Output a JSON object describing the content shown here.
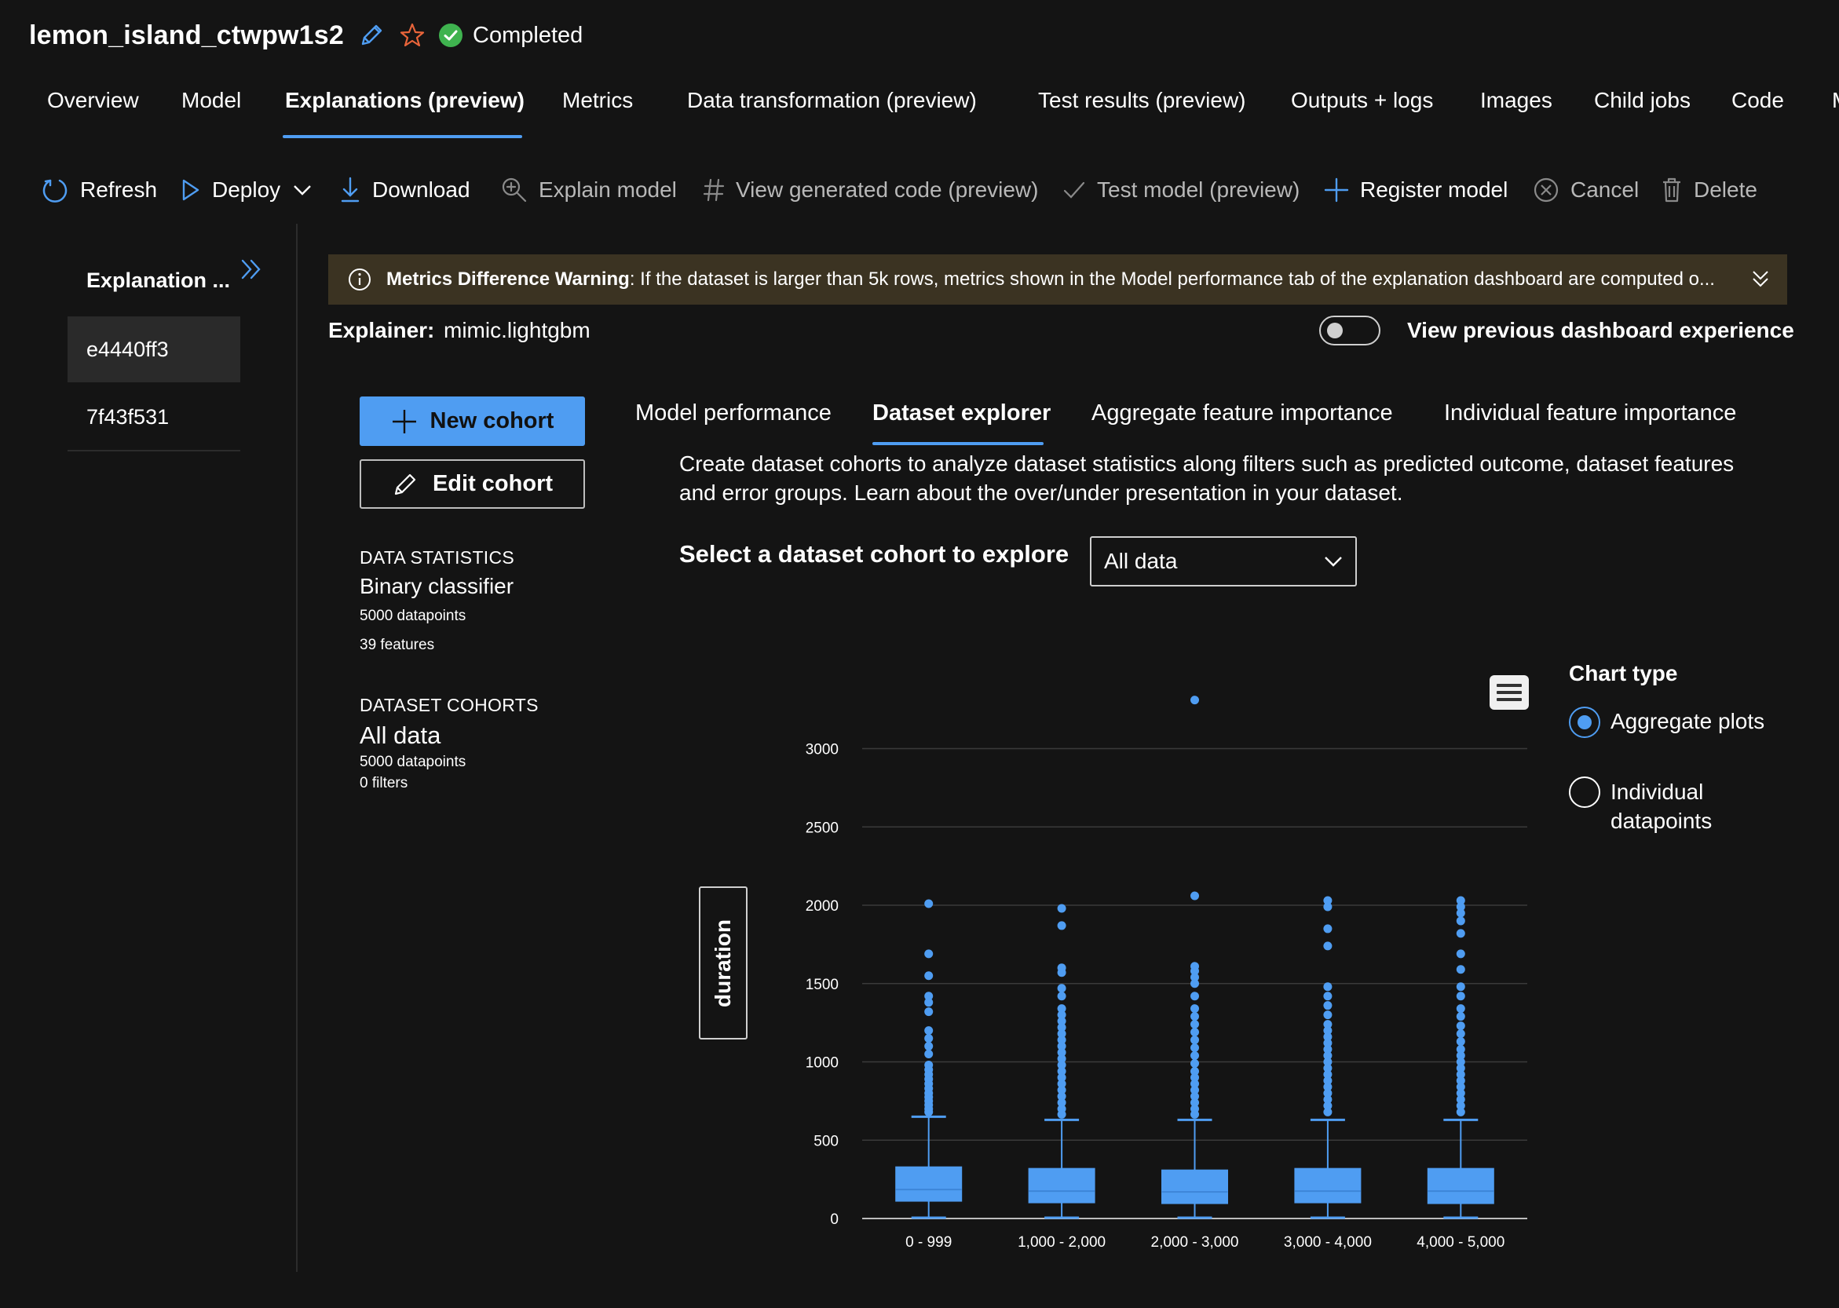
{
  "header": {
    "job_title": "lemon_island_ctwpw1s2",
    "status": "Completed"
  },
  "nav": {
    "tabs": [
      {
        "label": "Overview"
      },
      {
        "label": "Model"
      },
      {
        "label": "Explanations (preview)",
        "active": true
      },
      {
        "label": "Metrics"
      },
      {
        "label": "Data transformation (preview)"
      },
      {
        "label": "Test results (preview)"
      },
      {
        "label": "Outputs + logs"
      },
      {
        "label": "Images"
      },
      {
        "label": "Child jobs"
      },
      {
        "label": "Code"
      },
      {
        "label": "M"
      }
    ]
  },
  "toolbar": {
    "refresh": "Refresh",
    "deploy": "Deploy",
    "download": "Download",
    "explain_model": "Explain model",
    "view_generated_code": "View generated code (preview)",
    "test_model": "Test model (preview)",
    "register_model": "Register model",
    "cancel": "Cancel",
    "delete": "Delete"
  },
  "explanations": {
    "header": "Explanation ...",
    "items": [
      {
        "id": "e4440ff3",
        "selected": true
      },
      {
        "id": "7f43f531",
        "selected": false
      }
    ]
  },
  "warning": {
    "title": "Metrics Difference Warning",
    "text": ": If the dataset is larger than 5k rows, metrics shown in the Model performance tab of the explanation dashboard are computed o..."
  },
  "explainer": {
    "label": "Explainer:",
    "value": "mimic.lightgbm"
  },
  "toggle": {
    "label": "View previous dashboard experience",
    "on": false
  },
  "cohort_buttons": {
    "new": "New cohort",
    "edit": "Edit cohort"
  },
  "data_statistics": {
    "heading": "DATA STATISTICS",
    "type": "Binary classifier",
    "datapoints": "5000 datapoints",
    "features": "39 features"
  },
  "dataset_cohorts": {
    "heading": "DATASET COHORTS",
    "name": "All data",
    "datapoints": "5000 datapoints",
    "filters": "0 filters"
  },
  "inner_tabs": [
    {
      "label": "Model performance"
    },
    {
      "label": "Dataset explorer",
      "active": true
    },
    {
      "label": "Aggregate feature importance"
    },
    {
      "label": "Individual feature importance"
    }
  ],
  "description": "Create dataset cohorts to analyze dataset statistics along filters such as predicted outcome, dataset features and error groups. Learn about the over/under presentation in your dataset.",
  "cohort_select": {
    "label": "Select a dataset cohort to explore",
    "value": "All data"
  },
  "chart_type": {
    "title": "Chart type",
    "options": [
      {
        "label": "Aggregate plots",
        "checked": true
      },
      {
        "label": "Individual datapoints",
        "checked": false
      }
    ]
  },
  "colors": {
    "accent": "#4f9df2",
    "background": "#141414",
    "warning_bg": "#3b3322",
    "status_green": "#3fb34f",
    "star": "#e8643a"
  },
  "chart_data": {
    "type": "box",
    "ylabel": "duration",
    "xlabel": "",
    "ylim": [
      0,
      3300
    ],
    "yticks": [
      0,
      500,
      1000,
      1500,
      2000,
      2500,
      3000
    ],
    "grid": true,
    "categories": [
      "0 - 999",
      "1,000 - 2,000",
      "2,000 - 3,000",
      "3,000 - 4,000",
      "4,000 - 5,000"
    ],
    "boxes": [
      {
        "min": 5,
        "q1": 110,
        "median": 185,
        "q3": 330,
        "whisker_high": 650,
        "outliers": [
          2010,
          1690,
          1550,
          1420,
          1380,
          1320,
          1200,
          1150,
          1100,
          1050,
          980,
          950,
          920,
          890,
          860,
          830,
          800,
          775,
          750,
          725,
          700,
          680
        ]
      },
      {
        "min": 5,
        "q1": 100,
        "median": 175,
        "q3": 320,
        "whisker_high": 630,
        "outliers": [
          1980,
          1870,
          1600,
          1570,
          1470,
          1420,
          1340,
          1300,
          1260,
          1220,
          1180,
          1140,
          1100,
          1060,
          1020,
          980,
          940,
          900,
          860,
          820,
          780,
          740,
          700,
          665
        ]
      },
      {
        "min": 5,
        "q1": 95,
        "median": 170,
        "q3": 310,
        "whisker_high": 630,
        "outliers": [
          3310,
          2060,
          1610,
          1580,
          1540,
          1500,
          1420,
          1340,
          1290,
          1240,
          1190,
          1140,
          1090,
          1040,
          990,
          940,
          900,
          860,
          820,
          780,
          740,
          700,
          665
        ]
      },
      {
        "min": 5,
        "q1": 100,
        "median": 175,
        "q3": 320,
        "whisker_high": 630,
        "outliers": [
          2030,
          1990,
          1850,
          1740,
          1480,
          1420,
          1360,
          1300,
          1240,
          1200,
          1160,
          1120,
          1080,
          1040,
          1000,
          960,
          920,
          880,
          840,
          800,
          760,
          720,
          680
        ]
      },
      {
        "min": 5,
        "q1": 95,
        "median": 175,
        "q3": 320,
        "whisker_high": 630,
        "outliers": [
          2030,
          1990,
          1950,
          1900,
          1820,
          1690,
          1590,
          1480,
          1420,
          1340,
          1290,
          1230,
          1180,
          1130,
          1080,
          1040,
          1000,
          960,
          920,
          880,
          840,
          800,
          760,
          720,
          680
        ]
      }
    ]
  }
}
